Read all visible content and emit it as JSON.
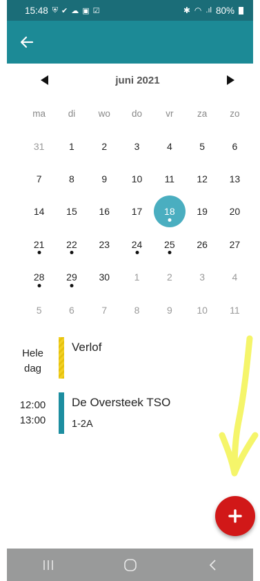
{
  "status_bar": {
    "time": "15:48",
    "battery": "80%",
    "left_icons": [
      "shield-icon",
      "check-icon",
      "cloud-icon",
      "image-icon",
      "checkbox-icon"
    ],
    "right_icons": [
      "bluetooth-icon",
      "wifi-icon",
      "signal-icon",
      "battery-icon"
    ]
  },
  "app_bar": {
    "icon": "back-arrow-icon",
    "color": "#1c8a96"
  },
  "calendar": {
    "month_title": "juni 2021",
    "weekdays": [
      "ma",
      "di",
      "wo",
      "do",
      "vr",
      "za",
      "zo"
    ],
    "weeks": [
      [
        {
          "d": "31",
          "muted": true
        },
        {
          "d": "1"
        },
        {
          "d": "2"
        },
        {
          "d": "3"
        },
        {
          "d": "4"
        },
        {
          "d": "5"
        },
        {
          "d": "6"
        }
      ],
      [
        {
          "d": "7"
        },
        {
          "d": "8"
        },
        {
          "d": "9"
        },
        {
          "d": "10"
        },
        {
          "d": "11"
        },
        {
          "d": "12"
        },
        {
          "d": "13"
        }
      ],
      [
        {
          "d": "14"
        },
        {
          "d": "15"
        },
        {
          "d": "16"
        },
        {
          "d": "17"
        },
        {
          "d": "18",
          "selected": true,
          "dot": true
        },
        {
          "d": "19"
        },
        {
          "d": "20"
        }
      ],
      [
        {
          "d": "21",
          "dot": true
        },
        {
          "d": "22",
          "dot": true
        },
        {
          "d": "23"
        },
        {
          "d": "24",
          "dot": true
        },
        {
          "d": "25",
          "dot": true
        },
        {
          "d": "26"
        },
        {
          "d": "27"
        }
      ],
      [
        {
          "d": "28",
          "dot": true
        },
        {
          "d": "29",
          "dot": true
        },
        {
          "d": "30"
        },
        {
          "d": "1",
          "muted": true
        },
        {
          "d": "2",
          "muted": true
        },
        {
          "d": "3",
          "muted": true
        },
        {
          "d": "4",
          "muted": true
        }
      ],
      [
        {
          "d": "5",
          "muted": true
        },
        {
          "d": "6",
          "muted": true
        },
        {
          "d": "7",
          "muted": true
        },
        {
          "d": "8",
          "muted": true
        },
        {
          "d": "9",
          "muted": true
        },
        {
          "d": "10",
          "muted": true
        },
        {
          "d": "11",
          "muted": true
        }
      ]
    ],
    "selected_color": "#4aaec0"
  },
  "events": [
    {
      "time_line1": "Hele",
      "time_line2": "dag",
      "title": "Verlof",
      "subtitle": "",
      "color": "#f2d024"
    },
    {
      "time_line1": "12:00",
      "time_line2": "13:00",
      "title": "De Oversteek TSO",
      "subtitle": "1-2A",
      "color": "#1d8ea0"
    }
  ],
  "fab": {
    "icon": "plus-icon",
    "color": "#d11818"
  },
  "nav_bar": {
    "buttons": [
      "recent-apps-icon",
      "home-icon",
      "back-icon"
    ]
  }
}
